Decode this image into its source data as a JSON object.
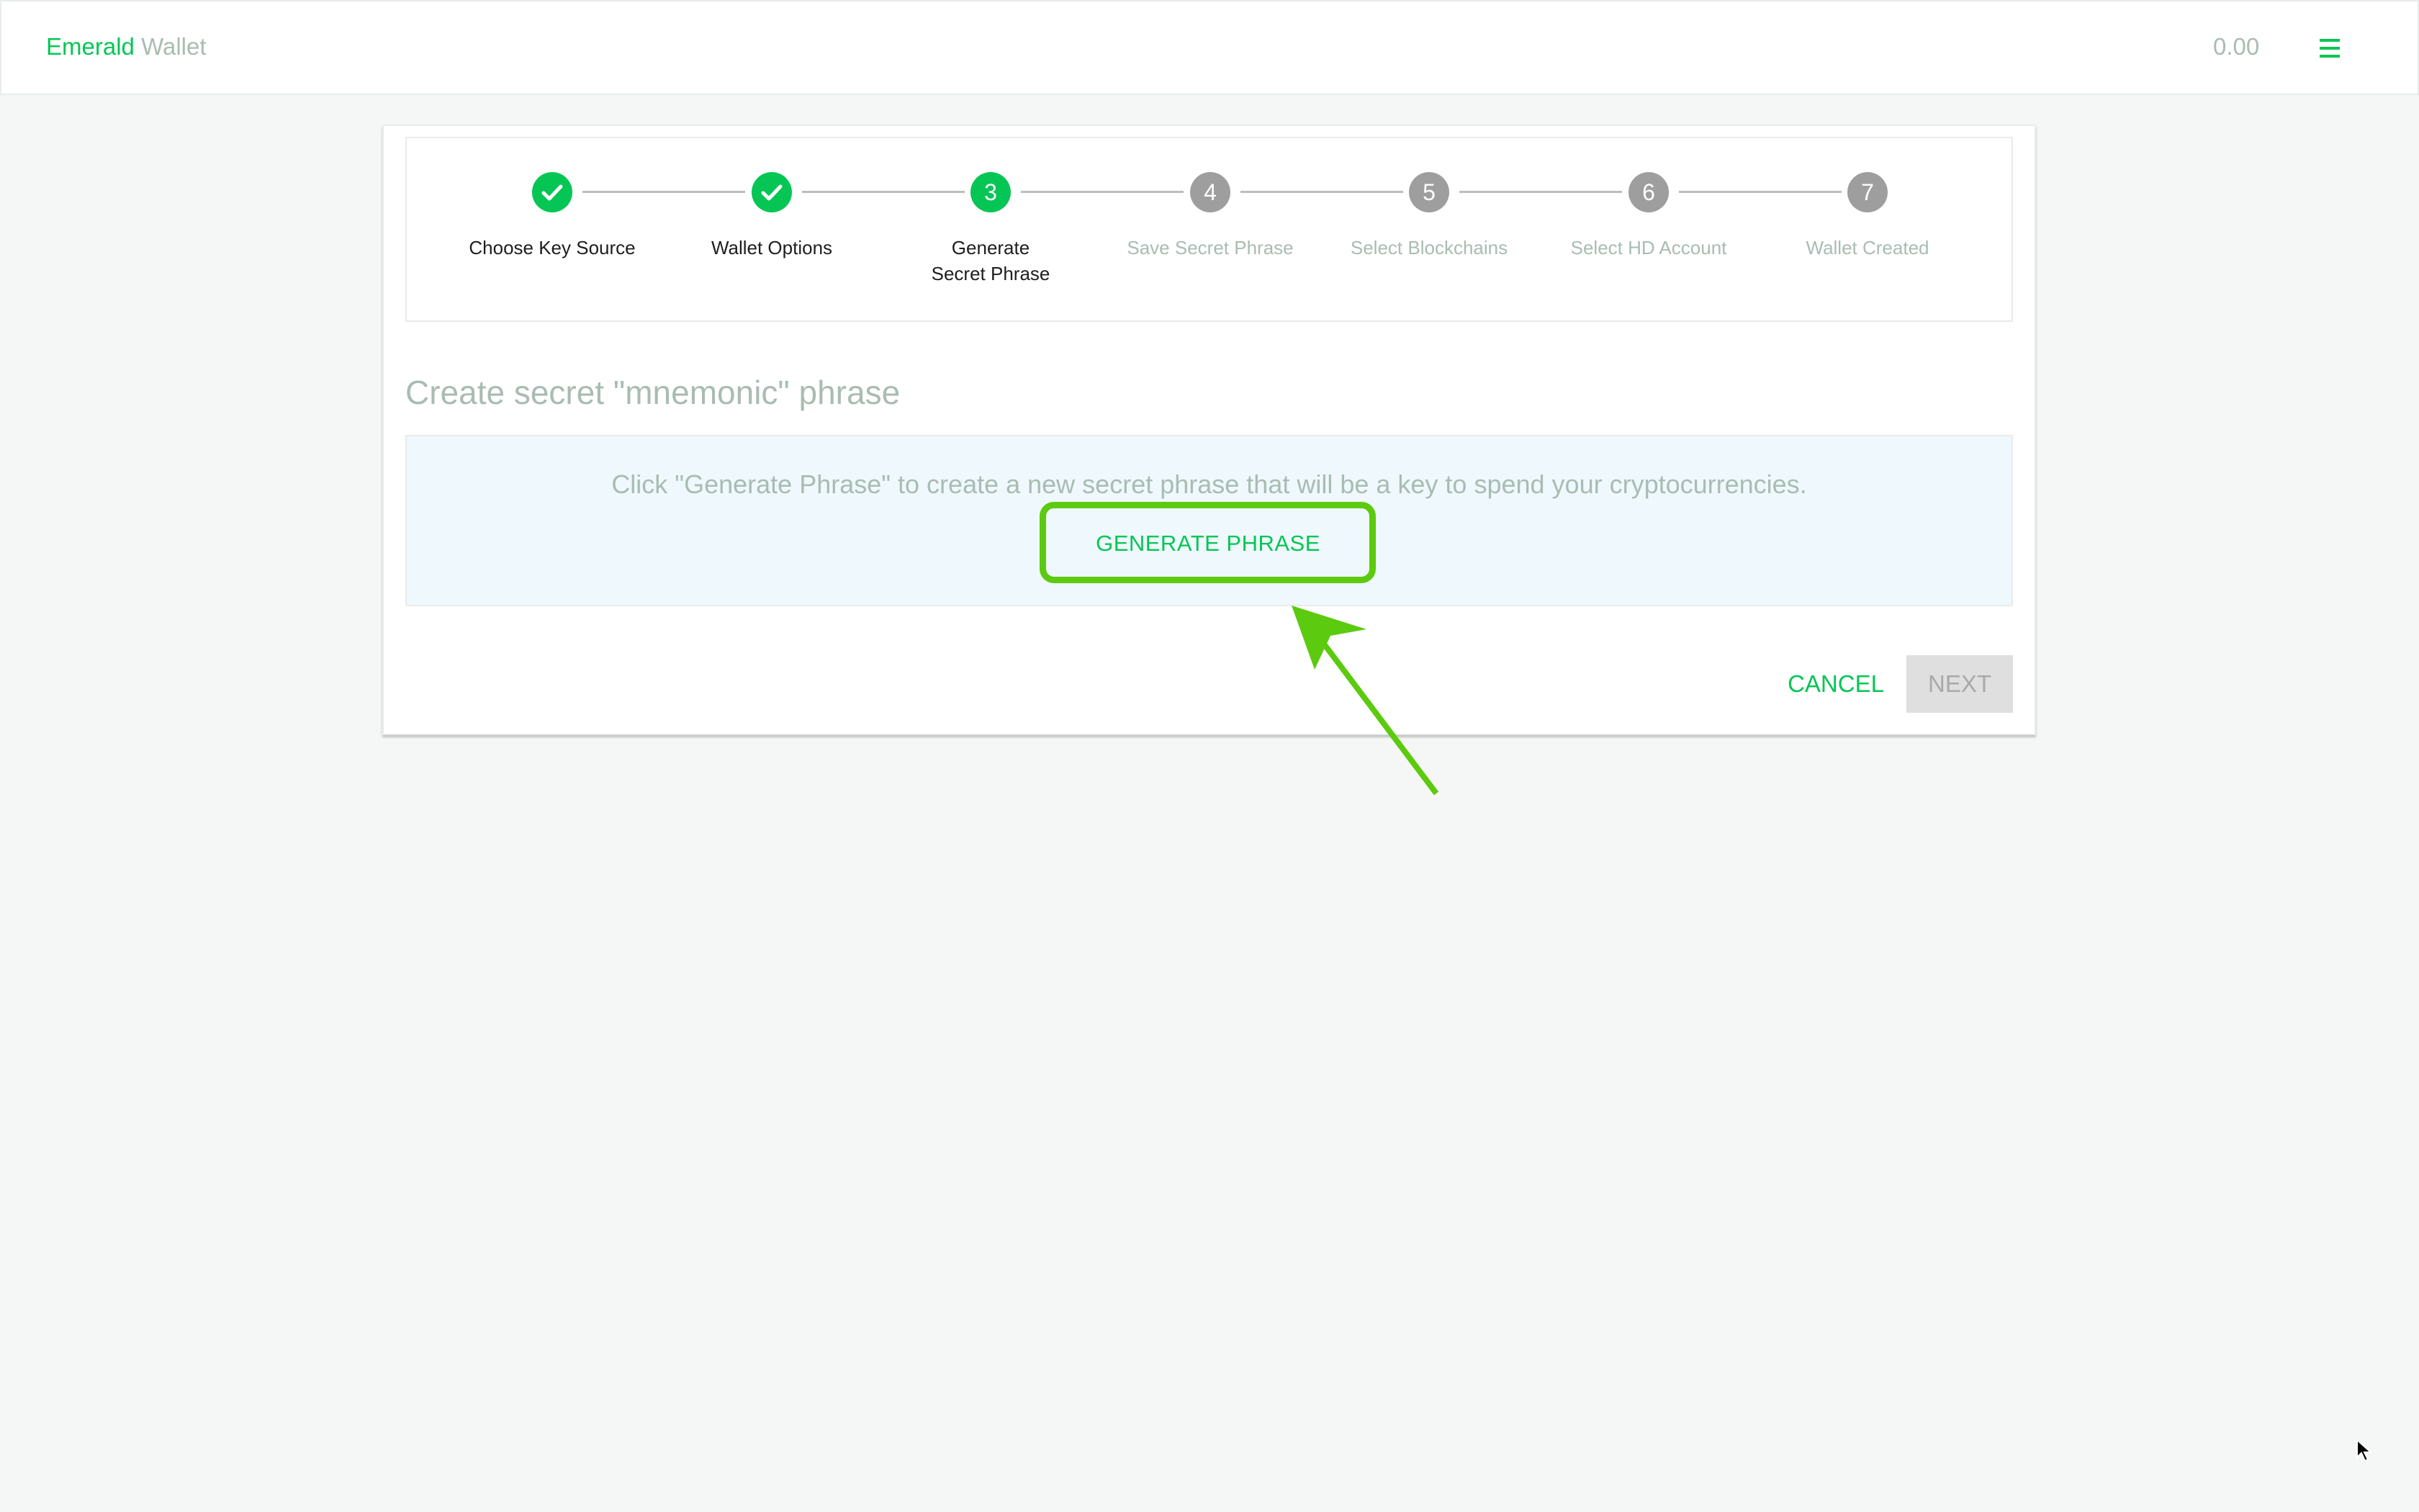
{
  "header": {
    "brand_primary": "Emerald",
    "brand_secondary": "Wallet",
    "balance": "0.00",
    "menu_icon": "hamburger-menu-icon"
  },
  "stepper": {
    "steps": [
      {
        "index": "1",
        "label": "Choose Key Source",
        "state": "completed",
        "icon": "check-icon"
      },
      {
        "index": "2",
        "label": "Wallet Options",
        "state": "completed",
        "icon": "check-icon"
      },
      {
        "index": "3",
        "label": "Generate Secret Phrase",
        "state": "active"
      },
      {
        "index": "4",
        "label": "Save Secret Phrase",
        "state": "pending"
      },
      {
        "index": "5",
        "label": "Select Blockchains",
        "state": "pending"
      },
      {
        "index": "6",
        "label": "Select HD Account",
        "state": "pending"
      },
      {
        "index": "7",
        "label": "Wallet Created",
        "state": "pending"
      }
    ]
  },
  "main": {
    "title": "Create secret \"mnemonic\" phrase",
    "info_text": "Click \"Generate Phrase\" to create a new secret phrase that will be a key to spend your cryptocurrencies.",
    "generate_button": "GENERATE PHRASE",
    "cancel_button": "CANCEL",
    "next_button": "NEXT",
    "next_disabled": true
  },
  "colors": {
    "accent": "#05c654",
    "muted_text": "#a9bcb2",
    "pending_step": "#9e9e9e",
    "info_background": "#eff8fd",
    "annotation": "#5cca0e"
  }
}
